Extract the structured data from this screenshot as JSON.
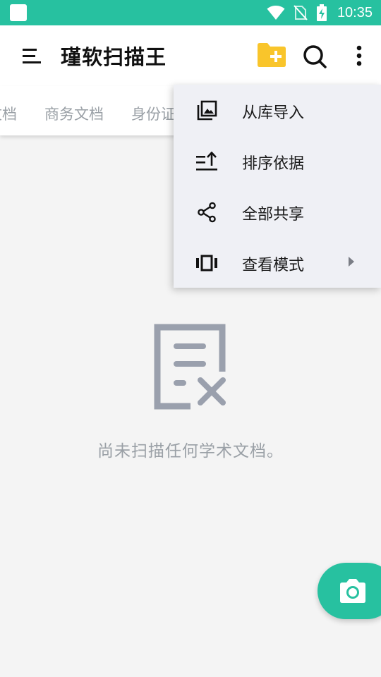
{
  "status_bar": {
    "time": "10:35"
  },
  "app_bar": {
    "title": "瑾软扫描王"
  },
  "tabs": [
    {
      "label": "文档"
    },
    {
      "label": "商务文档"
    },
    {
      "label": "身份证"
    }
  ],
  "empty_state": {
    "message": "尚未扫描任何学术文档。"
  },
  "overflow_menu": {
    "items": [
      {
        "label": "从库导入",
        "icon": "gallery-icon"
      },
      {
        "label": "排序依据",
        "icon": "sort-icon"
      },
      {
        "label": "全部共享",
        "icon": "share-icon"
      },
      {
        "label": "查看模式",
        "icon": "view-mode-icon",
        "has_submenu": true
      }
    ]
  },
  "colors": {
    "accent": "#27c1a0",
    "folder": "#f9c52b",
    "muted_text": "#9aa0a6",
    "empty_icon": "#9aa0ad"
  }
}
